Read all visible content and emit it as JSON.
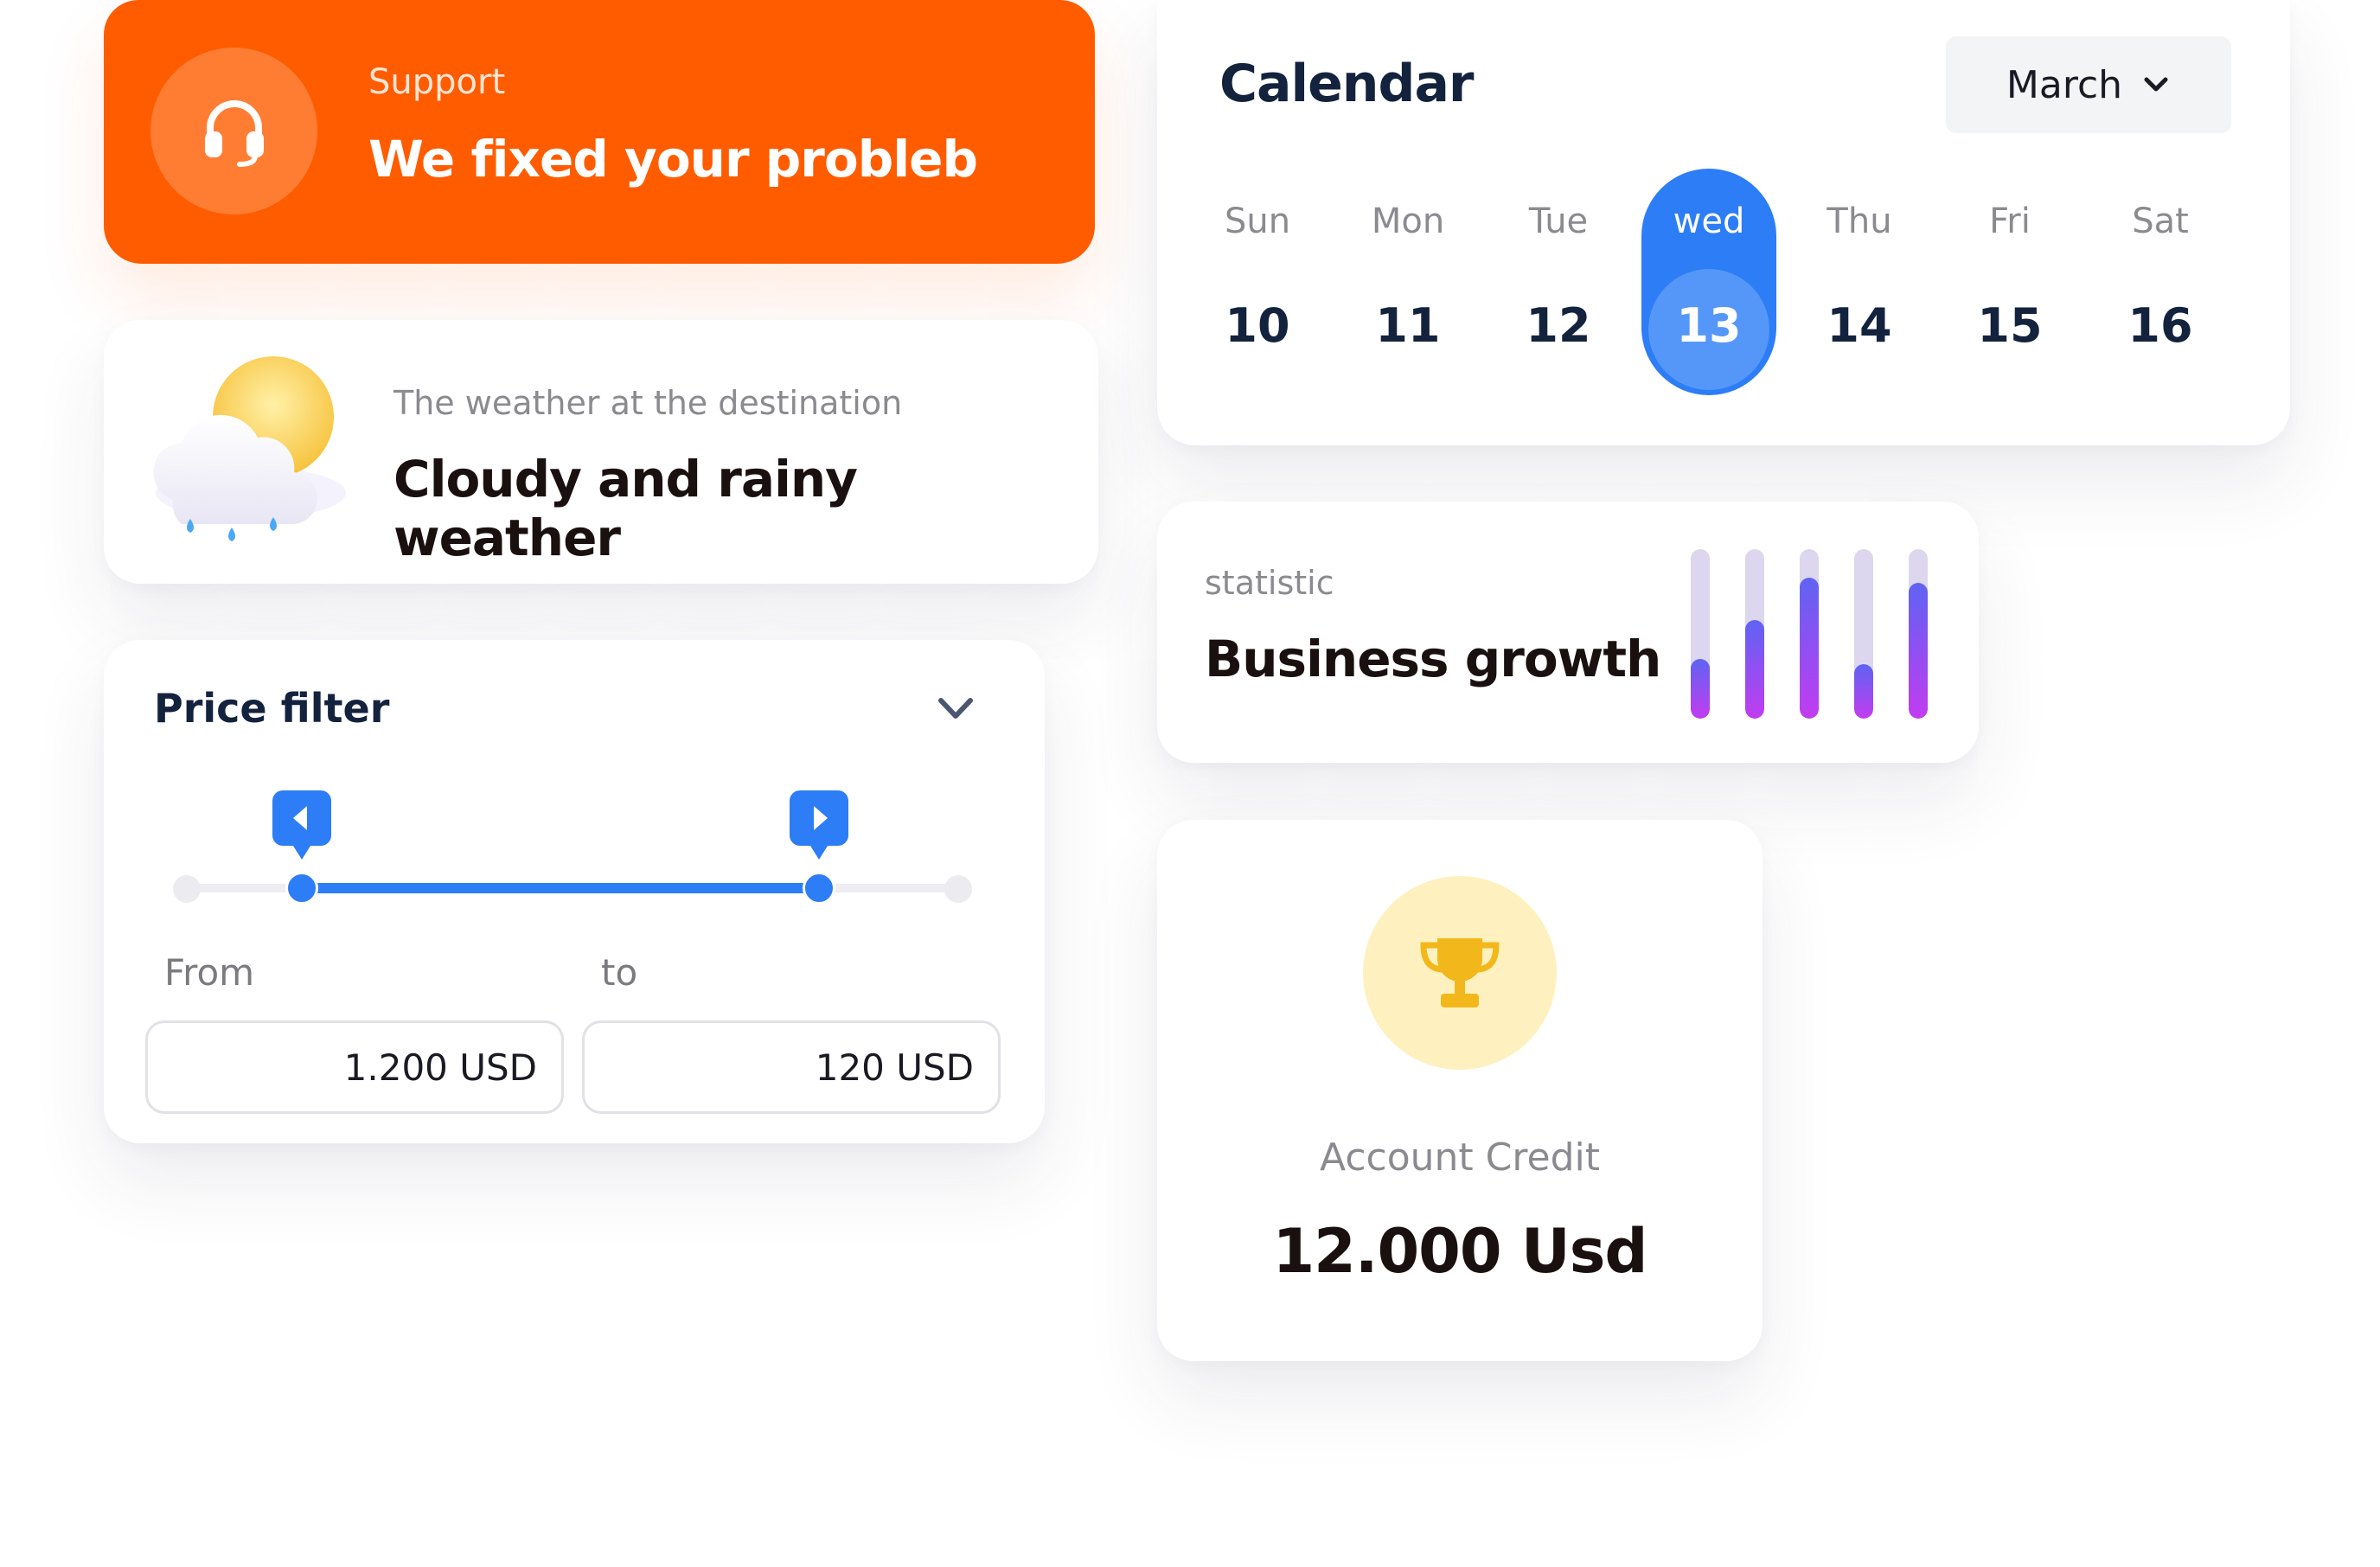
{
  "support": {
    "label": "Support",
    "message": "We fixed your probleb",
    "icon": "headset-icon",
    "color": "#ff5c00"
  },
  "weather": {
    "label": "The weather at the destination",
    "condition": "Cloudy and rainy weather",
    "icon": "cloud-rain-sun-icon"
  },
  "price_filter": {
    "title": "Price filter",
    "range_start_fraction": 0.15,
    "range_end_fraction": 0.82,
    "from_label": "From",
    "to_label": "to",
    "from_value": "1.200 USD",
    "to_value": "120 USD",
    "accent": "#2c7df6"
  },
  "calendar": {
    "title": "Calendar",
    "month": "March",
    "days": [
      {
        "name": "Sun",
        "num": "10"
      },
      {
        "name": "Mon",
        "num": "11"
      },
      {
        "name": "Tue",
        "num": "12"
      },
      {
        "name": "wed",
        "num": "13",
        "selected": true
      },
      {
        "name": "Thu",
        "num": "14"
      },
      {
        "name": "Fri",
        "num": "15"
      },
      {
        "name": "Sat",
        "num": "16"
      }
    ]
  },
  "statistic": {
    "label": "statistic",
    "title": "Business growth",
    "bar_levels": [
      0.35,
      0.58,
      0.83,
      0.32,
      0.8
    ]
  },
  "credit": {
    "label": "Account Credit",
    "amount": "12.000 Usd",
    "icon": "trophy-icon"
  }
}
